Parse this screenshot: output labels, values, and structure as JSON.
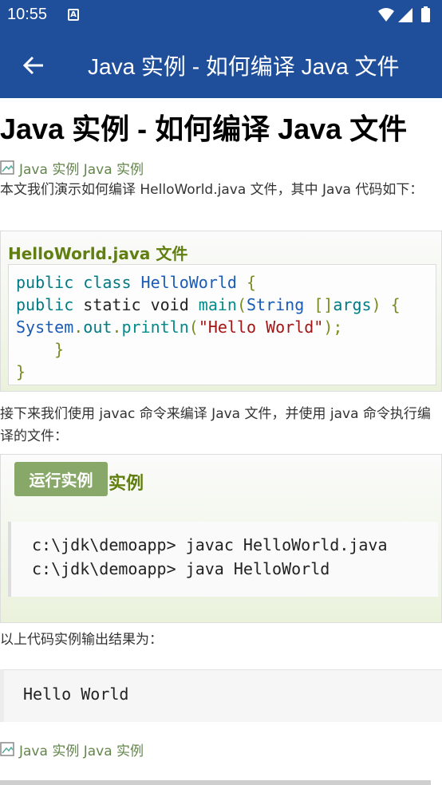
{
  "status": {
    "time": "10:55",
    "notif_glyph": "A"
  },
  "app_bar": {
    "title": "Java 实例 - 如何编译 Java 文件"
  },
  "page": {
    "heading": "Java 实例 - 如何编译 Java 文件",
    "crumb_top": "Java 实例 Java 实例",
    "intro": "本文我们演示如何编译 HelloWorld.java 文件，其中 Java 代码如下：",
    "example1": {
      "title": "HelloWorld.java 文件",
      "code": {
        "l1_a": "public",
        "l1_b": " class",
        "l1_c": " HelloWorld",
        "l1_d": " {",
        "l2_a": "public",
        "l2_b": " static void ",
        "l2_c": "main",
        "l2_d": "(",
        "l2_e": "String",
        "l2_f": " []",
        "l2_g": "args",
        "l2_h": ")",
        "l2_i": " {",
        "l3_a": "System",
        "l3_b": ".",
        "l3_c": "out",
        "l3_d": ".",
        "l3_e": "println",
        "l3_f": "(",
        "l3_g": "\"Hello World\"",
        "l3_h": ");",
        "l4": "    }",
        "l5": "}"
      }
    },
    "para2": "接下来我们使用 javac 命令来编译 Java 文件，并使用 java 命令执行编译的文件：",
    "example2": {
      "run_button": "运行实例",
      "run_suffix": "»",
      "suffix_label": "实例",
      "line1": "c:\\jdk\\demoapp> javac HelloWorld.java",
      "line2": "c:\\jdk\\demoapp> java HelloWorld"
    },
    "para3": "以上代码实例输出结果为：",
    "output": "Hello World",
    "crumb_bottom": "Java 实例 Java 实例"
  }
}
